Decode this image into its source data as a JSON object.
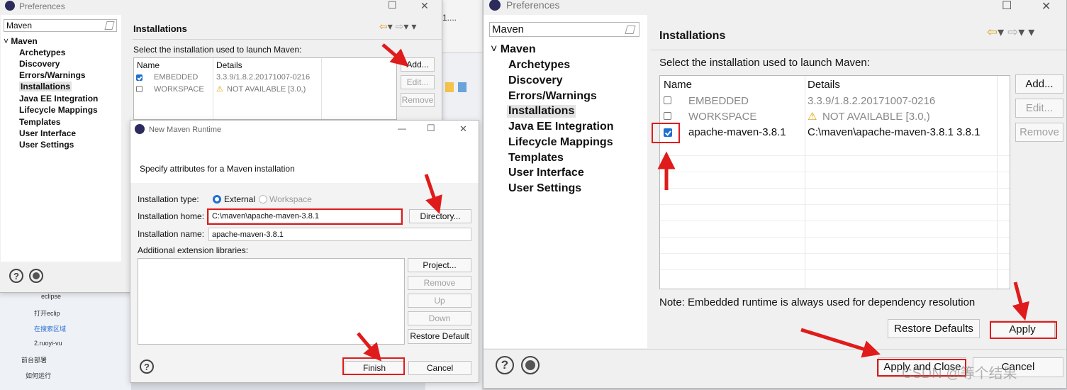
{
  "left_preferences": {
    "title": "Preferences",
    "filter_value": "Maven",
    "tree_root": "Maven",
    "tree_items": [
      "Archetypes",
      "Discovery",
      "Errors/Warnings",
      "Installations",
      "Java EE Integration",
      "Lifecycle Mappings",
      "Templates",
      "User Interface",
      "User Settings"
    ],
    "page_title": "Installations",
    "instruction": "Select the installation used to launch Maven:",
    "col_name": "Name",
    "col_details": "Details",
    "rows": [
      {
        "name": "EMBEDDED",
        "details": "3.3.9/1.8.2.20171007-0216",
        "checked": true
      },
      {
        "name": "WORKSPACE",
        "details": "NOT AVAILABLE [3.0,)",
        "checked": false
      }
    ],
    "add_label": "Add...",
    "edit_label": "Edit...",
    "remove_label": "Remove"
  },
  "new_runtime": {
    "title": "New Maven Runtime",
    "description": "Specify attributes for a Maven installation",
    "type_label": "Installation type:",
    "type_external": "External",
    "type_workspace": "Workspace",
    "home_label": "Installation home:",
    "home_value": "C:\\maven\\apache-maven-3.8.1",
    "directory_label": "Directory...",
    "name_label": "Installation name:",
    "name_value": "apache-maven-3.8.1",
    "ext_label": "Additional extension libraries:",
    "project_label": "Project...",
    "remove_label": "Remove",
    "up_label": "Up",
    "down_label": "Down",
    "restore_label": "Restore Default",
    "finish_label": "Finish",
    "cancel_label": "Cancel"
  },
  "background": {
    "tab_text": "1....",
    "sidebar_items": [
      "eclipse",
      "打开eclip",
      "在搜索区域",
      "2.ruoyi-vu",
      "前台部署",
      "如何运行"
    ]
  },
  "right_preferences": {
    "title": "Preferences",
    "filter_value": "Maven",
    "tree_root": "Maven",
    "tree_items": [
      "Archetypes",
      "Discovery",
      "Errors/Warnings",
      "Installations",
      "Java EE Integration",
      "Lifecycle Mappings",
      "Templates",
      "User Interface",
      "User Settings"
    ],
    "page_title": "Installations",
    "instruction": "Select the installation used to launch Maven:",
    "col_name": "Name",
    "col_details": "Details",
    "rows": [
      {
        "name": "EMBEDDED",
        "details": "3.3.9/1.8.2.20171007-0216",
        "checked": false
      },
      {
        "name": "WORKSPACE",
        "details": "NOT AVAILABLE [3.0,)",
        "checked": false
      },
      {
        "name": "apache-maven-3.8.1",
        "details": "C:\\maven\\apache-maven-3.8.1 3.8.1",
        "checked": true
      }
    ],
    "add_label": "Add...",
    "edit_label": "Edit...",
    "remove_label": "Remove",
    "note": "Note: Embedded runtime is always used for dependency resolution",
    "restore_label": "Restore Defaults",
    "apply_label": "Apply",
    "apply_close_label": "Apply and Close",
    "cancel_label": "Cancel"
  },
  "watermark": "CSDN @等个结果",
  "icons": {
    "help": "?",
    "warning": "⚠",
    "minimize": "—",
    "maximize": "☐",
    "close": "✕",
    "chevron": "⌄"
  },
  "colors": {
    "annotation": "#e01b1b",
    "checkbox_on": "#1f6fd0",
    "radio_on": "#1f6fd0"
  }
}
